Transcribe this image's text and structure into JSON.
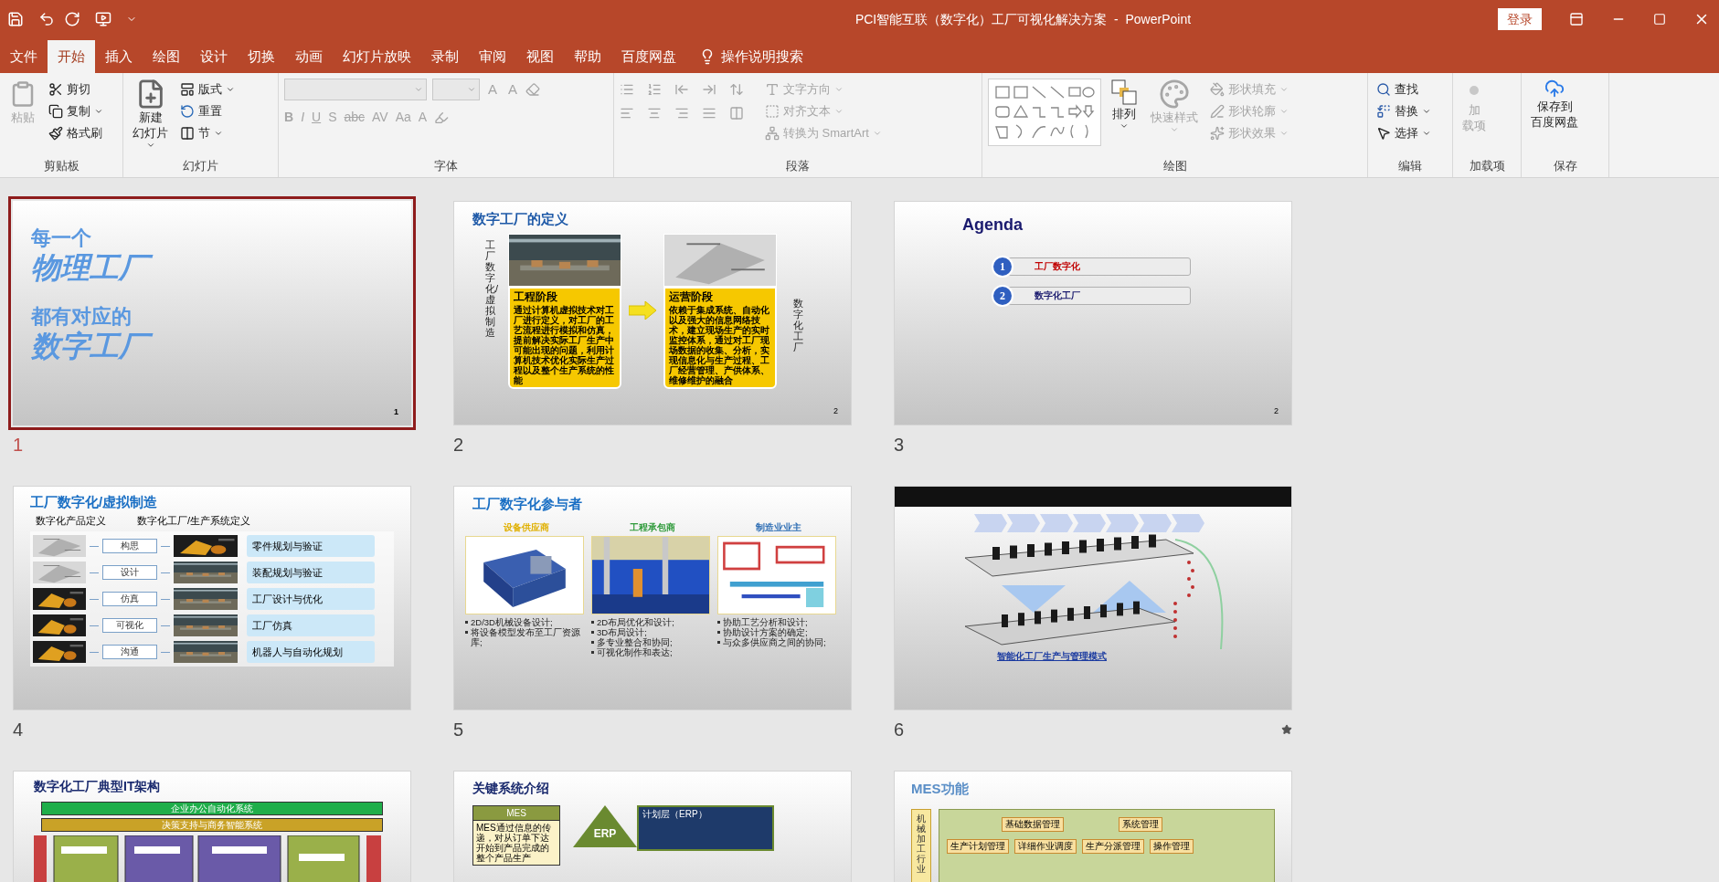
{
  "window": {
    "title": "PCI智能互联（数字化）工厂可视化解决方案  -  PowerPoint",
    "login": "登录"
  },
  "tabs": [
    {
      "label": "文件",
      "selected": false
    },
    {
      "label": "开始",
      "selected": true
    },
    {
      "label": "插入",
      "selected": false
    },
    {
      "label": "绘图",
      "selected": false
    },
    {
      "label": "设计",
      "selected": false
    },
    {
      "label": "切换",
      "selected": false
    },
    {
      "label": "动画",
      "selected": false
    },
    {
      "label": "幻灯片放映",
      "selected": false
    },
    {
      "label": "录制",
      "selected": false
    },
    {
      "label": "审阅",
      "selected": false
    },
    {
      "label": "视图",
      "selected": false
    },
    {
      "label": "帮助",
      "selected": false
    },
    {
      "label": "百度网盘",
      "selected": false
    }
  ],
  "tell_me": "操作说明搜索",
  "ribbon": {
    "groups": [
      {
        "label": "剪贴板",
        "items": [
          {
            "lines": [
              "粘贴"
            ],
            "disabled": true
          },
          {
            "lines": [
              "剪切"
            ],
            "disabled": false
          },
          {
            "lines": [
              "复制"
            ],
            "disabled": false
          },
          {
            "lines": [
              "格式刷"
            ],
            "disabled": false
          }
        ]
      },
      {
        "label": "幻灯片",
        "items": [
          {
            "lines": [
              "新建",
              "幻灯片"
            ],
            "disabled": false
          },
          {
            "lines": [
              "版式"
            ],
            "disabled": false
          },
          {
            "lines": [
              "重置"
            ],
            "disabled": false
          },
          {
            "lines": [
              "节"
            ],
            "disabled": false
          }
        ]
      },
      {
        "label": "字体",
        "fields": [
          {
            "disabled": true
          },
          {
            "disabled": true
          }
        ],
        "glyphs_top": [
          {
            "text": "A",
            "disabled": true
          },
          {
            "text": "A",
            "disabled": true
          }
        ],
        "glyphs_bottom": [
          {
            "text": "B",
            "disabled": true
          },
          {
            "text": "I",
            "disabled": true
          },
          {
            "text": "U",
            "disabled": true
          },
          {
            "text": "S",
            "disabled": true
          },
          {
            "text": "abc",
            "disabled": true
          },
          {
            "text": "AV",
            "disabled": true
          },
          {
            "text": "Aa",
            "disabled": true
          },
          {
            "text": "A",
            "disabled": true
          }
        ]
      },
      {
        "label": "段落",
        "items": [
          {
            "lines": [
              "文字方向"
            ],
            "disabled": true
          },
          {
            "lines": [
              "对齐文本"
            ],
            "disabled": true
          },
          {
            "lines": [
              "转换为 SmartArt"
            ],
            "disabled": true
          }
        ]
      },
      {
        "label": "绘图",
        "items": [
          {
            "lines": [
              "排列"
            ],
            "disabled": false
          },
          {
            "lines": [
              "快速样式"
            ],
            "disabled": true
          },
          {
            "lines": [
              "形状填充"
            ],
            "disabled": true
          },
          {
            "lines": [
              "形状轮廓"
            ],
            "disabled": true
          },
          {
            "lines": [
              "形状效果"
            ],
            "disabled": true
          }
        ]
      },
      {
        "label": "编辑",
        "items": [
          {
            "lines": [
              "查找"
            ],
            "disabled": false
          },
          {
            "lines": [
              "替换"
            ],
            "disabled": false
          },
          {
            "lines": [
              "选择"
            ],
            "disabled": false
          }
        ]
      },
      {
        "label": "加载项",
        "items": [
          {
            "lines": [
              "加",
              "载项"
            ],
            "disabled": true
          }
        ]
      },
      {
        "label": "保存",
        "items": [
          {
            "lines": [
              "保存到",
              "百度网盘"
            ],
            "disabled": false
          }
        ]
      }
    ]
  },
  "slides": [
    {
      "number": "1",
      "selected": true,
      "animated": false,
      "kind": "title",
      "page": "1",
      "lines": [
        {
          "text": "每一个",
          "emphasis": false
        },
        {
          "text": "物理工厂",
          "emphasis": true
        },
        {
          "text": "都有对应的",
          "emphasis": false
        },
        {
          "text": "数字工厂",
          "emphasis": true
        }
      ]
    },
    {
      "number": "2",
      "selected": false,
      "animated": false,
      "kind": "definition",
      "page": "2",
      "title": "数字工厂的定义",
      "left_vertical": "工厂数字化/虚拟制造",
      "right_vertical": "数字化工厂",
      "cards": [
        {
          "heading": "工程阶段",
          "body": "通过计算机虚拟技术对工厂进行定义，对工厂的工艺流程进行模拟和仿真，提前解决实际工厂生产中可能出现的问题，利用计算机技术优化实际生产过程以及整个生产系统的性能"
        },
        {
          "heading": "运营阶段",
          "body": "依赖于集成系统、自动化以及强大的信息网络技术，建立现场生产的实时监控体系，通过对工厂现场数据的收集、分析，实现信息化与生产过程、工厂经营管理、产供体系、维修维护的融合"
        }
      ]
    },
    {
      "number": "3",
      "selected": false,
      "animated": false,
      "kind": "agenda",
      "page": "2",
      "title": "Agenda",
      "items": [
        {
          "num": "1",
          "text": "工厂数字化",
          "highlighted": true
        },
        {
          "num": "2",
          "text": "数字化工厂",
          "highlighted": false
        }
      ]
    },
    {
      "number": "4",
      "selected": false,
      "animated": false,
      "kind": "virtual",
      "title": "工厂数字化/虚拟制造",
      "subtitles": [
        "数字化产品定义",
        "数字化工厂/生产系统定义"
      ],
      "steps": [
        "构思",
        "设计",
        "仿真",
        "可视化",
        "沟通"
      ],
      "capabilities": [
        "零件规划与验证",
        "装配规划与验证",
        "工厂设计与优化",
        "工厂仿真",
        "机器人与自动化规划"
      ]
    },
    {
      "number": "5",
      "selected": false,
      "animated": false,
      "kind": "participants",
      "title": "工厂数字化参与者",
      "columns": [
        {
          "heading": "设备供应商",
          "color": "#e0b000",
          "bullets": [
            "2D/3D机械设备设计;",
            "将设备模型发布至工厂资源库;"
          ]
        },
        {
          "heading": "工程承包商",
          "color": "#2e9a3a",
          "bullets": [
            "2D布局优化和设计;",
            "3D布局设计;",
            "多专业整合和协同;",
            "可视化制作和表达;"
          ]
        },
        {
          "heading": "制造业业主",
          "color": "#2f6fb5",
          "bullets": [
            "协助工艺分析和设计;",
            "协助设计方案的确定;",
            "与众多供应商之间的协同;"
          ]
        }
      ]
    },
    {
      "number": "6",
      "selected": false,
      "animated": true,
      "kind": "diagram",
      "caption": "智能化工厂生产与管理模式"
    },
    {
      "selected": false,
      "kind": "architecture",
      "title": "数字化工厂典型IT架构",
      "bars": [
        {
          "text": "企业办公自动化系统",
          "color": "#1fae4a"
        },
        {
          "text": "决策支持与商务智能系统",
          "color": "#c9a227"
        }
      ]
    },
    {
      "selected": false,
      "kind": "systems",
      "title": "关键系统介绍",
      "mes_label": "MES",
      "mes_text": "MES通过信息的传递，对从订单下达开始到产品完成的整个产品生产",
      "erp_label": "ERP",
      "erp_heading": "计划层（ERP）"
    },
    {
      "selected": false,
      "kind": "functions",
      "title": "MES功能",
      "side": "机械加工行业",
      "upper_boxes": [
        "基础数据管理",
        "系统管理"
      ],
      "lower_boxes": [
        "生产计划管理",
        "详细作业调度",
        "生产分派管理",
        "操作管理"
      ]
    }
  ]
}
